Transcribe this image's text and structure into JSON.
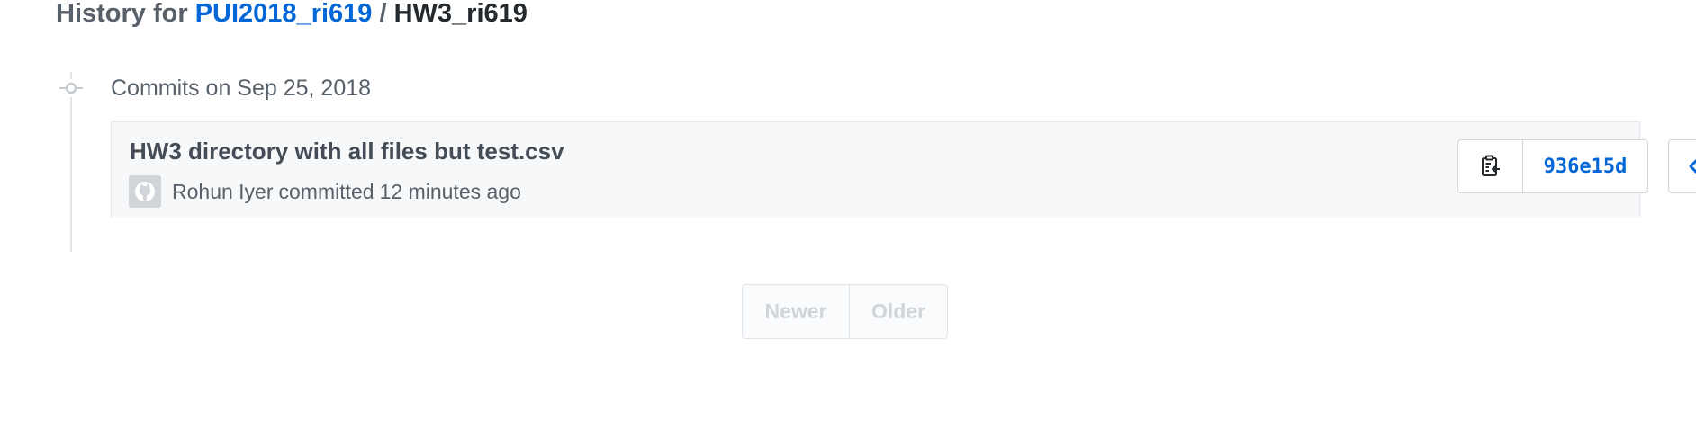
{
  "header": {
    "prefix": "History for",
    "repo": "PUI2018_ri619",
    "separator": "/",
    "path": "HW3_ri619"
  },
  "timeline": {
    "date_heading": "Commits on Sep 25, 2018"
  },
  "commit": {
    "title": "HW3 directory with all files but test.csv",
    "author": "Rohun Iyer",
    "action": "committed",
    "time": "12 minutes ago",
    "sha": "936e15d",
    "icons": {
      "copy": "clippy-icon",
      "browse": "code-icon",
      "avatar": "github-octocat-icon",
      "timeline": "git-commit-icon"
    }
  },
  "pagination": {
    "newer_label": "Newer",
    "older_label": "Older"
  },
  "colors": {
    "link": "#0366d6",
    "muted": "#586069",
    "row_bg": "#f6f8fa",
    "border": "#d1d5da",
    "disabled": "#d1d5da"
  }
}
